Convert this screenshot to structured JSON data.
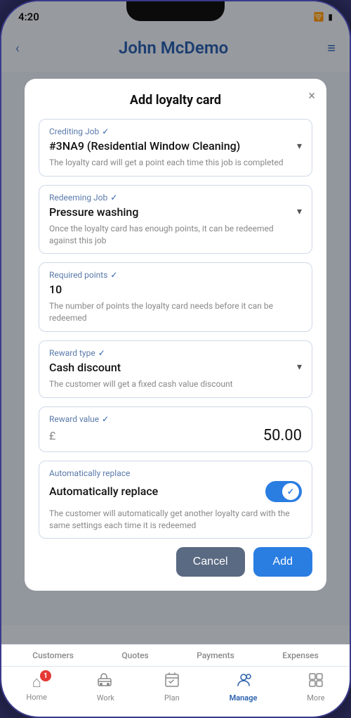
{
  "status_bar": {
    "time": "4:20",
    "wifi": "📶",
    "battery": "🔋"
  },
  "header": {
    "title": "John McDemo",
    "back_label": "‹",
    "menu_label": "≡"
  },
  "modal": {
    "title": "Add loyalty card",
    "close_label": "×",
    "fields": {
      "crediting_job": {
        "label": "Crediting Job",
        "value": "#3NA9 (Residential Window Cleaning)",
        "hint": "The loyalty card will get a point each time this job is completed"
      },
      "redeeming_job": {
        "label": "Redeeming Job",
        "value": "Pressure washing",
        "hint": "Once the loyalty card has enough points, it can be redeemed against this job"
      },
      "required_points": {
        "label": "Required points",
        "value": "10",
        "hint": "The number of points the loyalty card needs before it can be redeemed"
      },
      "reward_type": {
        "label": "Reward type",
        "value": "Cash discount",
        "hint": "The customer will get a fixed cash value discount"
      },
      "reward_value": {
        "label": "Reward value",
        "currency": "£",
        "value": "50.00"
      },
      "auto_replace": {
        "container_label": "Automatically replace",
        "toggle_label": "Automatically replace",
        "hint": "The customer will automatically get another loyalty card with the same settings each time it is redeemed"
      }
    },
    "buttons": {
      "cancel": "Cancel",
      "add": "Add"
    }
  },
  "bottom_nav": {
    "tabs_label": [
      "Customers",
      "Quotes",
      "Payments",
      "Expenses"
    ],
    "items": [
      {
        "id": "home",
        "label": "Home",
        "icon": "⌂",
        "active": false,
        "badge": "1"
      },
      {
        "id": "work",
        "label": "Work",
        "icon": "🚚",
        "active": false,
        "badge": null
      },
      {
        "id": "plan",
        "label": "Plan",
        "icon": "📋",
        "active": false,
        "badge": null
      },
      {
        "id": "manage",
        "label": "Manage",
        "icon": "👥",
        "active": true,
        "badge": null
      },
      {
        "id": "more",
        "label": "More",
        "icon": "⊞",
        "active": false,
        "badge": null
      }
    ]
  }
}
